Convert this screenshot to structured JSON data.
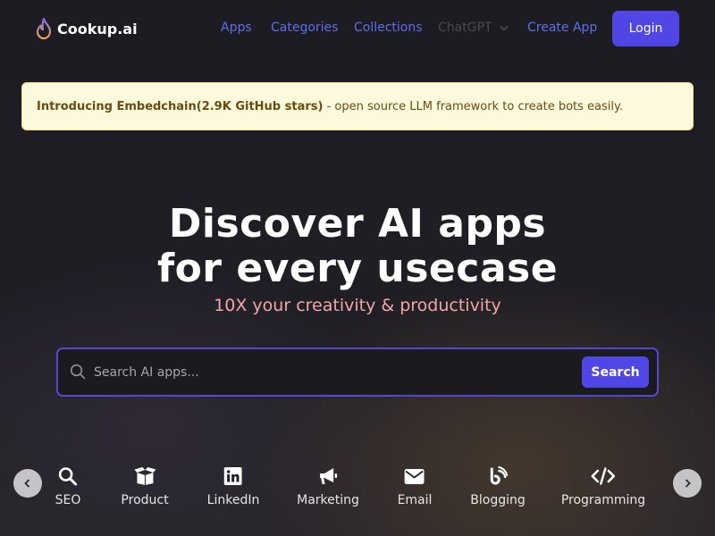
{
  "brand": {
    "name": "Cookup.ai",
    "icon": "flame-icon",
    "accent": "#4f46e5"
  },
  "nav": {
    "links": [
      "Apps",
      "Categories",
      "Collections"
    ],
    "chatgpt": {
      "label": "ChatGPT",
      "icon": "chevron-down-icon"
    },
    "create": "Create App",
    "login": "Login"
  },
  "banner": {
    "link_text": "Introducing Embedchain(2.9K GitHub stars)",
    "rest_text": " - open source LLM framework to create bots easily."
  },
  "hero": {
    "title_line1": "Discover AI apps",
    "title_line2": "for every usecase",
    "subtitle": "10X your creativity & productivity"
  },
  "search": {
    "placeholder": "Search AI apps...",
    "button": "Search"
  },
  "categories": [
    {
      "label": "SEO",
      "icon": "search-icon"
    },
    {
      "label": "Product",
      "icon": "box-icon"
    },
    {
      "label": "LinkedIn",
      "icon": "linkedin-icon"
    },
    {
      "label": "Marketing",
      "icon": "megaphone-icon"
    },
    {
      "label": "Email",
      "icon": "envelope-icon"
    },
    {
      "label": "Blogging",
      "icon": "blog-icon"
    },
    {
      "label": "Programming",
      "icon": "code-icon"
    }
  ],
  "carousel": {
    "prev_icon": "chevron-left-icon",
    "next_icon": "chevron-right-icon"
  }
}
